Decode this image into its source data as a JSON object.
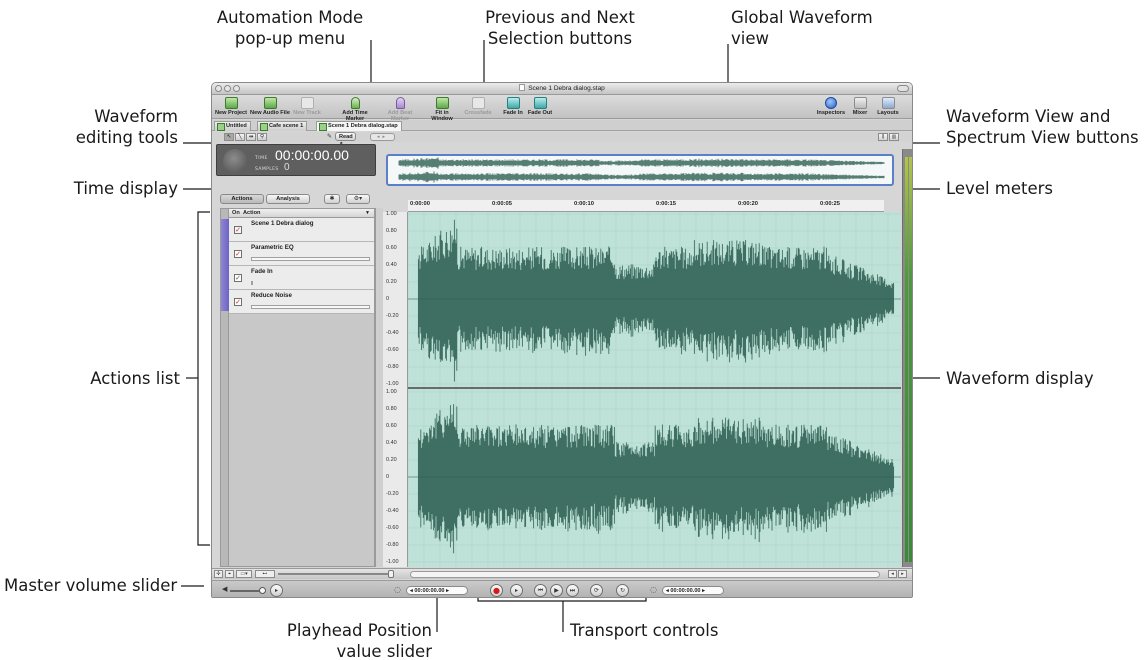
{
  "callouts": {
    "automation_mode": "Automation Mode\npop-up menu",
    "prev_next_selection": "Previous and Next\nSelection buttons",
    "global_waveform": "Global Waveform\nview",
    "waveform_editing_tools": "Waveform\nediting tools",
    "waveform_spectrum_buttons": "Waveform View and\nSpectrum View buttons",
    "time_display": "Time display",
    "level_meters": "Level meters",
    "actions_list": "Actions list",
    "waveform_display": "Waveform display",
    "master_volume": "Master volume slider",
    "playhead_position": "Playhead Position\nvalue slider",
    "transport_controls": "Transport controls"
  },
  "window": {
    "title": "Scene 1 Debra dialog.stap"
  },
  "toolbar": {
    "new_project": "New Project",
    "new_audio_file": "New Audio File",
    "new_track": "New Track",
    "add_time_marker": "Add Time Marker",
    "add_beat_marker": "Add Beat Marker",
    "fit_in_window": "Fit in Window",
    "crossfade": "Crossfade",
    "fade_in": "Fade In",
    "fade_out": "Fade Out",
    "inspectors": "Inspectors",
    "mixer": "Mixer",
    "layouts": "Layouts"
  },
  "tabs": [
    "Untitled",
    "Cafe scene 1",
    "Scene 1 Debra dialog.stap"
  ],
  "automation": {
    "mode": "Read"
  },
  "time_display": {
    "time_label": "TIME",
    "time": "00:00:00.00",
    "samples_label": "SAMPLES",
    "samples": "0"
  },
  "actions_panel": {
    "tab_actions": "Actions",
    "tab_analysis": "Analysis",
    "col_on": "On",
    "col_action": "Action",
    "items": [
      {
        "name": "Scene 1 Debra dialog",
        "checked": true
      },
      {
        "name": "Parametric EQ",
        "checked": true
      },
      {
        "name": "Fade In",
        "checked": true
      },
      {
        "name": "Reduce Noise",
        "checked": true
      }
    ]
  },
  "ruler": [
    "0:00:00",
    "0:00:05",
    "0:00:10",
    "0:00:15",
    "0:00:20",
    "0:00:25"
  ],
  "amplitude_labels": [
    "1.00",
    "0.80",
    "0.60",
    "0.40",
    "0.20",
    "0",
    "-0.20",
    "-0.40",
    "-0.60",
    "-0.80",
    "-1.00"
  ],
  "transport": {
    "playhead_position": "00:00:00.00",
    "secondary_position": "00:00:00.00"
  },
  "colors": {
    "waveform_fill": "#3f6f62",
    "waveform_bg": "#bfe2d8",
    "selection_border": "#5b7fc8",
    "record_red": "#d21a1a"
  }
}
